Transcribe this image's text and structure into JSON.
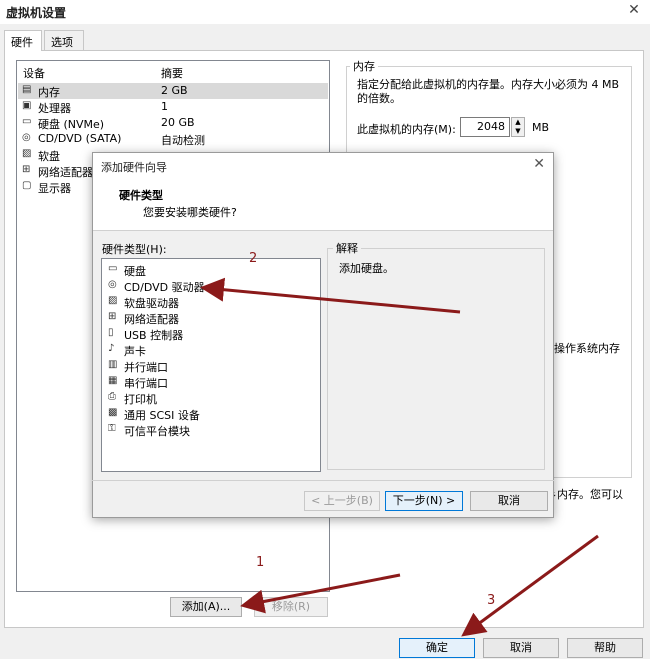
{
  "window": {
    "title": "虚拟机设置",
    "close": "✕"
  },
  "tabs": [
    {
      "label": "硬件"
    },
    {
      "label": "选项"
    }
  ],
  "devices": {
    "col_device": "设备",
    "col_summary": "摘要",
    "rows": [
      {
        "name": "内存",
        "summary": "2 GB",
        "icon": "memory-icon",
        "glyph": "▤"
      },
      {
        "name": "处理器",
        "summary": "1",
        "icon": "processor-icon",
        "glyph": "▣"
      },
      {
        "name": "硬盘 (NVMe)",
        "summary": "20 GB",
        "icon": "hard-disk-icon",
        "glyph": "▭"
      },
      {
        "name": "CD/DVD (SATA)",
        "summary": "自动检测",
        "icon": "cd-dvd-icon",
        "glyph": "◎"
      },
      {
        "name": "软盘",
        "summary": "",
        "icon": "floppy-icon",
        "glyph": "▨"
      },
      {
        "name": "网络适配器",
        "summary": "",
        "icon": "network-adapter-icon",
        "glyph": "⊞"
      },
      {
        "name": "显示器",
        "summary": "",
        "icon": "display-icon",
        "glyph": "▢"
      }
    ],
    "add_button": "添加(A)...",
    "remove_button": "移除(R)"
  },
  "memory": {
    "group_title": "内存",
    "description": "指定分配给此虚拟机的内存量。内存大小必须为 4 MB 的倍数。",
    "field_label": "此虚拟机的内存(M):",
    "value": "2048",
    "unit": "MB",
    "fragment_os": "操作系统内存",
    "fragment_hint": "彡内存。您可以"
  },
  "wizard": {
    "title": "添加硬件向导",
    "close": "✕",
    "header_title": "硬件类型",
    "header_subtitle": "您要安装哪类硬件?",
    "list_label": "硬件类型(H):",
    "items": [
      {
        "name": "硬盘",
        "icon": "hard-disk-icon",
        "glyph": "▭"
      },
      {
        "name": "CD/DVD 驱动器",
        "icon": "cd-dvd-icon",
        "glyph": "◎"
      },
      {
        "name": "软盘驱动器",
        "icon": "floppy-icon",
        "glyph": "▨"
      },
      {
        "name": "网络适配器",
        "icon": "network-adapter-icon",
        "glyph": "⊞"
      },
      {
        "name": "USB 控制器",
        "icon": "usb-icon",
        "glyph": "▯"
      },
      {
        "name": "声卡",
        "icon": "sound-card-icon",
        "glyph": "♪"
      },
      {
        "name": "并行端口",
        "icon": "parallel-port-icon",
        "glyph": "▥"
      },
      {
        "name": "串行端口",
        "icon": "serial-port-icon",
        "glyph": "▦"
      },
      {
        "name": "打印机",
        "icon": "printer-icon",
        "glyph": "⎙"
      },
      {
        "name": "通用 SCSI 设备",
        "icon": "scsi-icon",
        "glyph": "▩"
      },
      {
        "name": "可信平台模块",
        "icon": "tpm-icon",
        "glyph": "⚿"
      }
    ],
    "explain_title": "解释",
    "explain_text": "添加硬盘。",
    "back_button": "< 上一步(B)",
    "next_button": "下一步(N) >",
    "cancel_button": "取消"
  },
  "footer": {
    "ok_button": "确定",
    "cancel_button": "取消",
    "help_button": "帮助"
  },
  "annotations": {
    "n1": "1",
    "n2": "2",
    "n3": "3",
    "color": "#8b1a1a"
  }
}
